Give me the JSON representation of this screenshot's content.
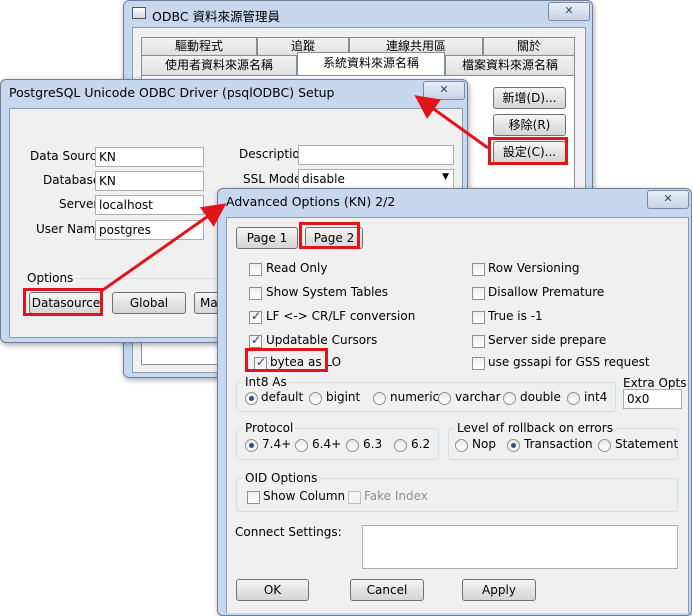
{
  "odbc": {
    "title": "ODBC 資料來源管理員",
    "close": "✕",
    "tabs_row1": [
      "驅動程式",
      "追蹤",
      "連線共用區",
      "關於"
    ],
    "tabs_row2": [
      "使用者資料來源名稱",
      "系統資料來源名稱",
      "檔案資料來源名稱"
    ],
    "btn_add": "新增(D)...",
    "btn_remove": "移除(R)",
    "btn_config": "設定(C)..."
  },
  "setup": {
    "title": "PostgreSQL Unicode ODBC Driver (psqlODBC) Setup",
    "close": "✕",
    "labels": {
      "datasource": "Data Source",
      "database": "Database",
      "server": "Server",
      "username": "User Name",
      "description": "Description",
      "sslmode": "SSL Mode",
      "options": "Options"
    },
    "values": {
      "datasource": "KN",
      "database": "KN",
      "server": "localhost",
      "username": "postgres",
      "description": "",
      "sslmode": "disable"
    },
    "buttons": {
      "datasource": "Datasource",
      "global": "Global",
      "manage": "Man"
    }
  },
  "advanced": {
    "title": "Advanced Options (KN) 2/2",
    "close": "✕",
    "page1": "Page 1",
    "page2": "Page 2",
    "checks_left": [
      {
        "label": "Read Only",
        "checked": false
      },
      {
        "label": "Show System Tables",
        "checked": false
      },
      {
        "label": "LF <-> CR/LF conversion",
        "checked": true
      },
      {
        "label": "Updatable Cursors",
        "checked": true
      },
      {
        "label": "bytea as LO",
        "checked": true
      }
    ],
    "checks_right": [
      {
        "label": "Row Versioning",
        "checked": false
      },
      {
        "label": "Disallow Premature",
        "checked": false
      },
      {
        "label": "True is -1",
        "checked": false
      },
      {
        "label": "Server side prepare",
        "checked": false
      },
      {
        "label": "use gssapi for GSS request",
        "checked": false
      }
    ],
    "int8": {
      "title": "Int8 As",
      "options": [
        "default",
        "bigint",
        "numeric",
        "varchar",
        "double",
        "int4"
      ],
      "selected": "default"
    },
    "extra_opts": {
      "label": "Extra Opts",
      "value": "0x0"
    },
    "protocol": {
      "title": "Protocol",
      "options": [
        "7.4+",
        "6.4+",
        "6.3",
        "6.2"
      ],
      "selected": "7.4+"
    },
    "rollback": {
      "title": "Level of rollback on errors",
      "options": [
        "Nop",
        "Transaction",
        "Statement"
      ],
      "selected": "Transaction"
    },
    "oid": {
      "title": "OID Options",
      "show_column": "Show Column",
      "fake_index": "Fake Index"
    },
    "connect_settings": {
      "label": "Connect Settings:",
      "value": ""
    },
    "buttons": {
      "ok": "OK",
      "cancel": "Cancel",
      "apply": "Apply"
    }
  },
  "annotation": {
    "color": "#e0141b"
  }
}
